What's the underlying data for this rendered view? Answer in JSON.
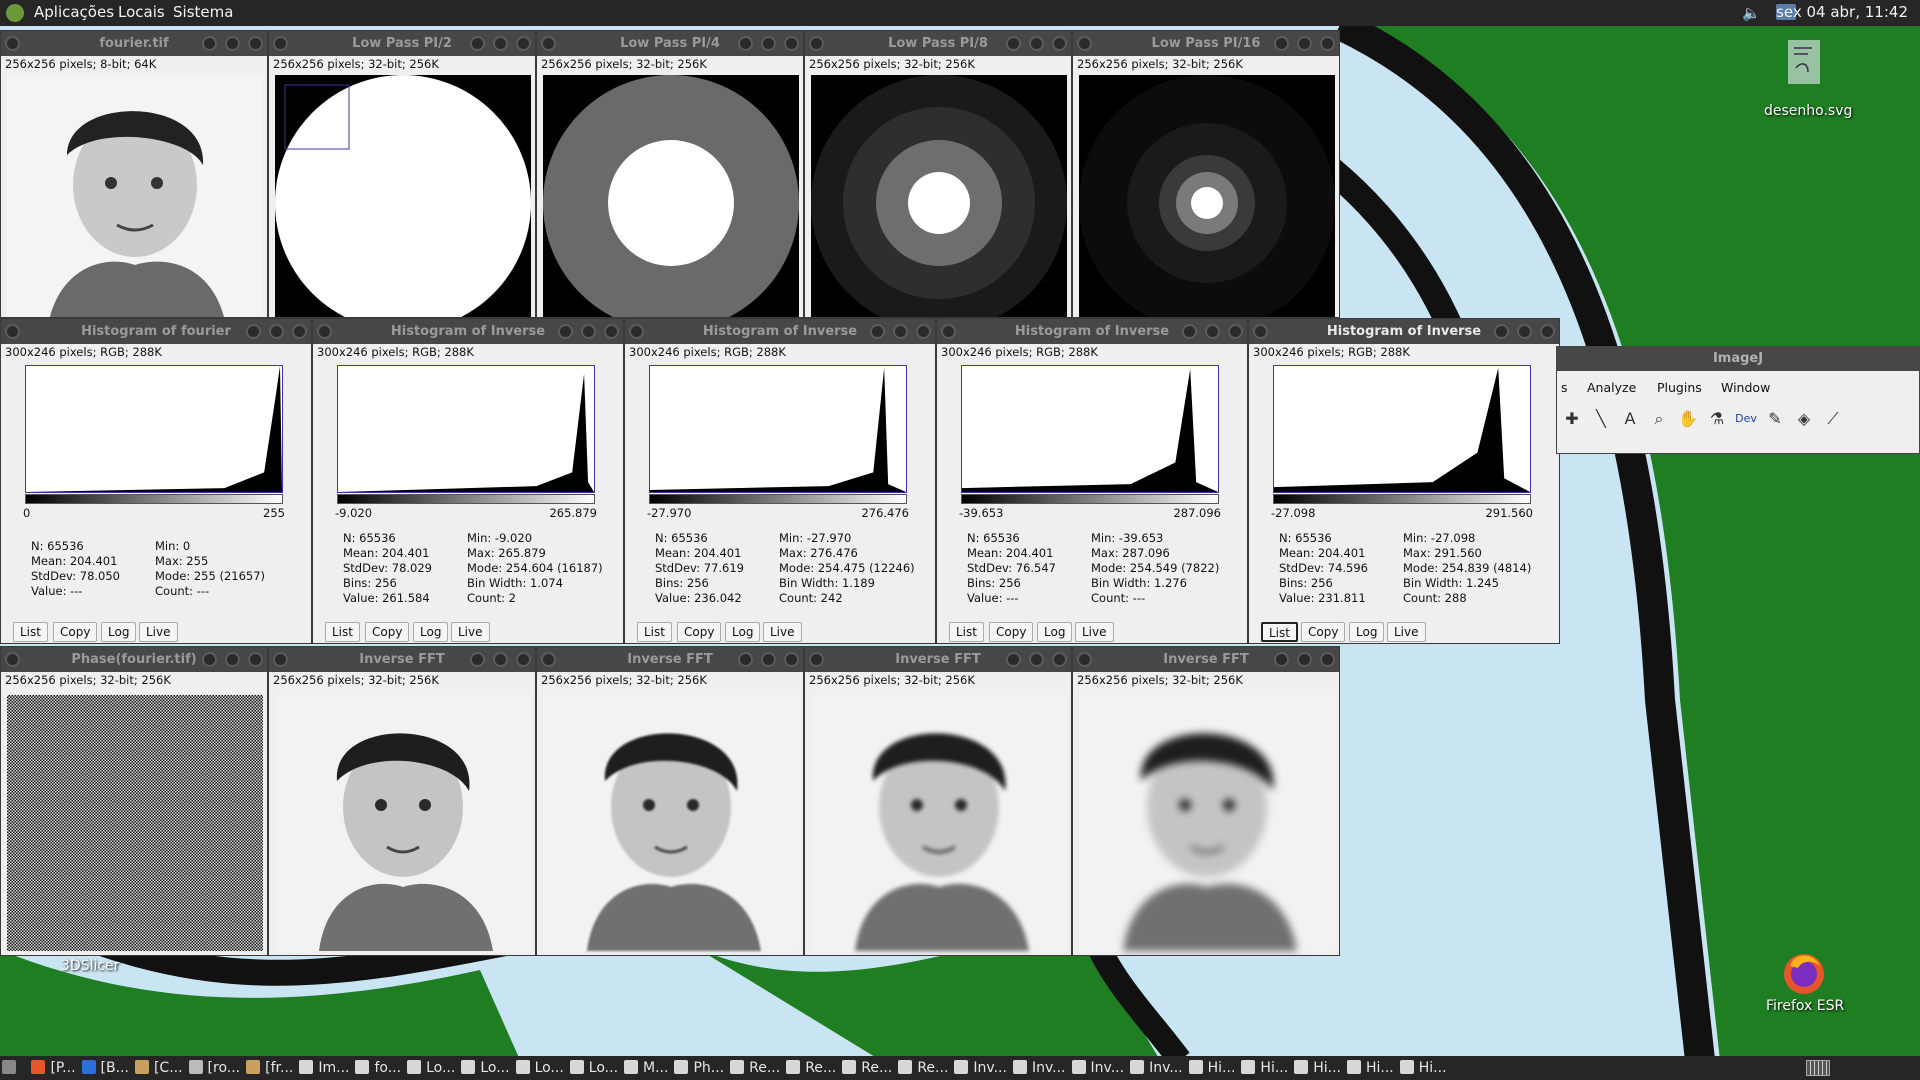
{
  "top_panel": {
    "menus": [
      "Aplicações",
      "Locais",
      "Sistema"
    ],
    "clock": "sex 04 abr, 11:42"
  },
  "desktop": {
    "icons": [
      {
        "label": "desenho.svg",
        "icon": "svg-file-icon"
      },
      {
        "label": "3DSlicer",
        "icon": "app-icon"
      },
      {
        "label": "Firefox ESR",
        "icon": "firefox-icon"
      }
    ]
  },
  "image_windows_row1": [
    {
      "title": "fourier.tif",
      "info": "256x256 pixels; 8-bit; 64K"
    },
    {
      "title": "Low Pass PI/2",
      "info": "256x256 pixels; 32-bit; 256K"
    },
    {
      "title": "Low Pass PI/4",
      "info": "256x256 pixels; 32-bit; 256K"
    },
    {
      "title": "Low Pass PI/8",
      "info": "256x256 pixels; 32-bit; 256K"
    },
    {
      "title": "Low Pass PI/16",
      "info": "256x256 pixels; 32-bit; 256K"
    }
  ],
  "histograms": [
    {
      "title": "Histogram of fourier",
      "info": "300x246 pixels; RGB; 288K",
      "min_label": "0",
      "max_label": "255",
      "left": [
        "N: 65536",
        "Mean: 204.401",
        "StdDev: 78.050",
        "Value: ---"
      ],
      "right": [
        "Min: 0",
        "Max: 255",
        "Mode: 255 (21657)",
        "Count: ---"
      ]
    },
    {
      "title": "Histogram of Inverse",
      "info": "300x246 pixels; RGB; 288K",
      "min_label": "-9.020",
      "max_label": "265.879",
      "left": [
        "N: 65536",
        "Mean: 204.401",
        "StdDev: 78.029",
        "Bins: 256",
        "Value: 261.584"
      ],
      "right": [
        "Min: -9.020",
        "Max: 265.879",
        "Mode: 254.604 (16187)",
        "Bin Width: 1.074",
        "Count: 2"
      ]
    },
    {
      "title": "Histogram of Inverse",
      "info": "300x246 pixels; RGB; 288K",
      "min_label": "-27.970",
      "max_label": "276.476",
      "left": [
        "N: 65536",
        "Mean: 204.401",
        "StdDev: 77.619",
        "Bins: 256",
        "Value: 236.042"
      ],
      "right": [
        "Min: -27.970",
        "Max: 276.476",
        "Mode: 254.475 (12246)",
        "Bin Width: 1.189",
        "Count: 242"
      ]
    },
    {
      "title": "Histogram of Inverse",
      "info": "300x246 pixels; RGB; 288K",
      "min_label": "-39.653",
      "max_label": "287.096",
      "left": [
        "N: 65536",
        "Mean: 204.401",
        "StdDev: 76.547",
        "Bins: 256",
        "Value: ---"
      ],
      "right": [
        "Min: -39.653",
        "Max: 287.096",
        "Mode: 254.549 (7822)",
        "Bin Width: 1.276",
        "Count: ---"
      ]
    },
    {
      "title": "Histogram of Inverse",
      "info": "300x246 pixels; RGB; 288K",
      "min_label": "-27.098",
      "max_label": "291.560",
      "left": [
        "N: 65536",
        "Mean: 204.401",
        "StdDev: 74.596",
        "Bins: 256",
        "Value: 231.811"
      ],
      "right": [
        "Min: -27.098",
        "Max: 291.560",
        "Mode: 254.839 (4814)",
        "Bin Width: 1.245",
        "Count: 288"
      ]
    }
  ],
  "histogram_buttons": [
    "List",
    "Copy",
    "Log",
    "Live"
  ],
  "image_windows_row2": [
    {
      "title": "Phase(fourier.tif)",
      "info": "256x256 pixels; 32-bit; 256K"
    },
    {
      "title": "Inverse FFT",
      "info": "256x256 pixels; 32-bit; 256K"
    },
    {
      "title": "Inverse FFT",
      "info": "256x256 pixels; 32-bit; 256K"
    },
    {
      "title": "Inverse FFT",
      "info": "256x256 pixels; 32-bit; 256K"
    },
    {
      "title": "Inverse FFT",
      "info": "256x256 pixels; 32-bit; 256K"
    }
  ],
  "imagej": {
    "title": "ImageJ",
    "menus": [
      "s",
      "Analyze",
      "Plugins",
      "Window"
    ],
    "tools": [
      "crosshair-icon",
      "line-icon",
      "text-icon",
      "zoom-icon",
      "hand-icon",
      "dropper-icon",
      "Dev",
      "brush-icon",
      "flood-icon",
      "pipette-icon"
    ]
  },
  "taskbar": [
    "[P...",
    "[B...",
    "[C...",
    "[ro...",
    "[fr...",
    "Im...",
    "fo...",
    "Lo...",
    "Lo...",
    "Lo...",
    "Lo...",
    "M...",
    "Ph...",
    "Re...",
    "Re...",
    "Re...",
    "Re...",
    "Inv...",
    "Inv...",
    "Inv...",
    "Inv...",
    "Hi...",
    "Hi...",
    "Hi...",
    "Hi...",
    "Hi..."
  ]
}
